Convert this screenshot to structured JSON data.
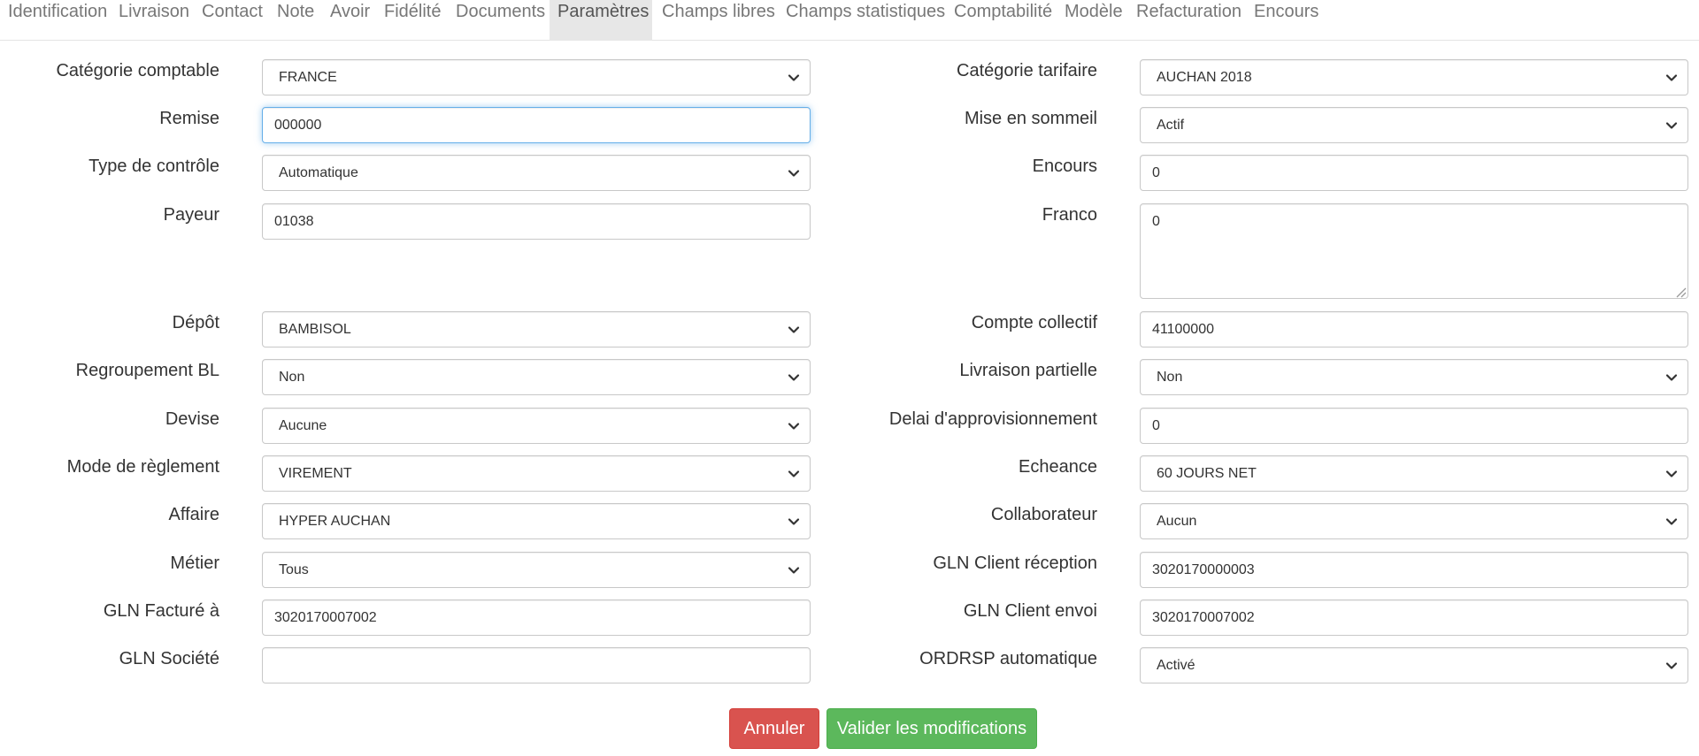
{
  "tabs": [
    {
      "label": "Identification"
    },
    {
      "label": "Livraison"
    },
    {
      "label": "Contact"
    },
    {
      "label": "Note"
    },
    {
      "label": "Avoir"
    },
    {
      "label": "Fidélité"
    },
    {
      "label": "Documents"
    },
    {
      "label": "Paramètres",
      "active": true
    },
    {
      "label": "Champs libres"
    },
    {
      "label": "Champs statistiques"
    },
    {
      "label": "Comptabilité"
    },
    {
      "label": "Modèle"
    },
    {
      "label": "Refacturation"
    },
    {
      "label": "Encours"
    }
  ],
  "form": {
    "categorie_comptable": {
      "label": "Catégorie comptable",
      "value": "FRANCE"
    },
    "remise": {
      "label": "Remise",
      "value": "000000"
    },
    "type_controle": {
      "label": "Type de contrôle",
      "value": "Automatique"
    },
    "payeur": {
      "label": "Payeur",
      "value": "01038"
    },
    "depot": {
      "label": "Dépôt",
      "value": "BAMBISOL"
    },
    "regroupement_bl": {
      "label": "Regroupement BL",
      "value": "Non"
    },
    "devise": {
      "label": "Devise",
      "value": "Aucune"
    },
    "mode_reglement": {
      "label": "Mode de règlement",
      "value": "VIREMENT"
    },
    "affaire": {
      "label": "Affaire",
      "value": "HYPER AUCHAN"
    },
    "metier": {
      "label": "Métier",
      "value": "Tous"
    },
    "gln_facture": {
      "label": "GLN Facturé à",
      "value": "3020170007002"
    },
    "gln_societe": {
      "label": "GLN Société",
      "value": ""
    },
    "categorie_tarifaire": {
      "label": "Catégorie tarifaire",
      "value": "AUCHAN 2018"
    },
    "mise_en_sommeil": {
      "label": "Mise en sommeil",
      "value": "Actif"
    },
    "encours": {
      "label": "Encours",
      "value": "0"
    },
    "franco": {
      "label": "Franco",
      "value": "0"
    },
    "compte_collectif": {
      "label": "Compte collectif",
      "value": "41100000"
    },
    "livraison_partielle": {
      "label": "Livraison partielle",
      "value": "Non"
    },
    "delai_appro": {
      "label": "Delai d'approvisionnement",
      "value": "0"
    },
    "echeance": {
      "label": "Echeance",
      "value": "60 JOURS NET"
    },
    "collaborateur": {
      "label": "Collaborateur",
      "value": "Aucun"
    },
    "gln_client_reception": {
      "label": "GLN Client réception",
      "value": "3020170000003"
    },
    "gln_client_envoi": {
      "label": "GLN Client envoi",
      "value": "3020170007002"
    },
    "ordrsp_auto": {
      "label": "ORDRSP automatique",
      "value": "Activé"
    }
  },
  "actions": {
    "cancel_label": "Annuler",
    "submit_label": "Valider les modifications"
  },
  "colors": {
    "cancel": "#d9534f",
    "submit": "#5cb85c",
    "focus": "#66afe9",
    "active_tab": "#e7e7e7"
  }
}
